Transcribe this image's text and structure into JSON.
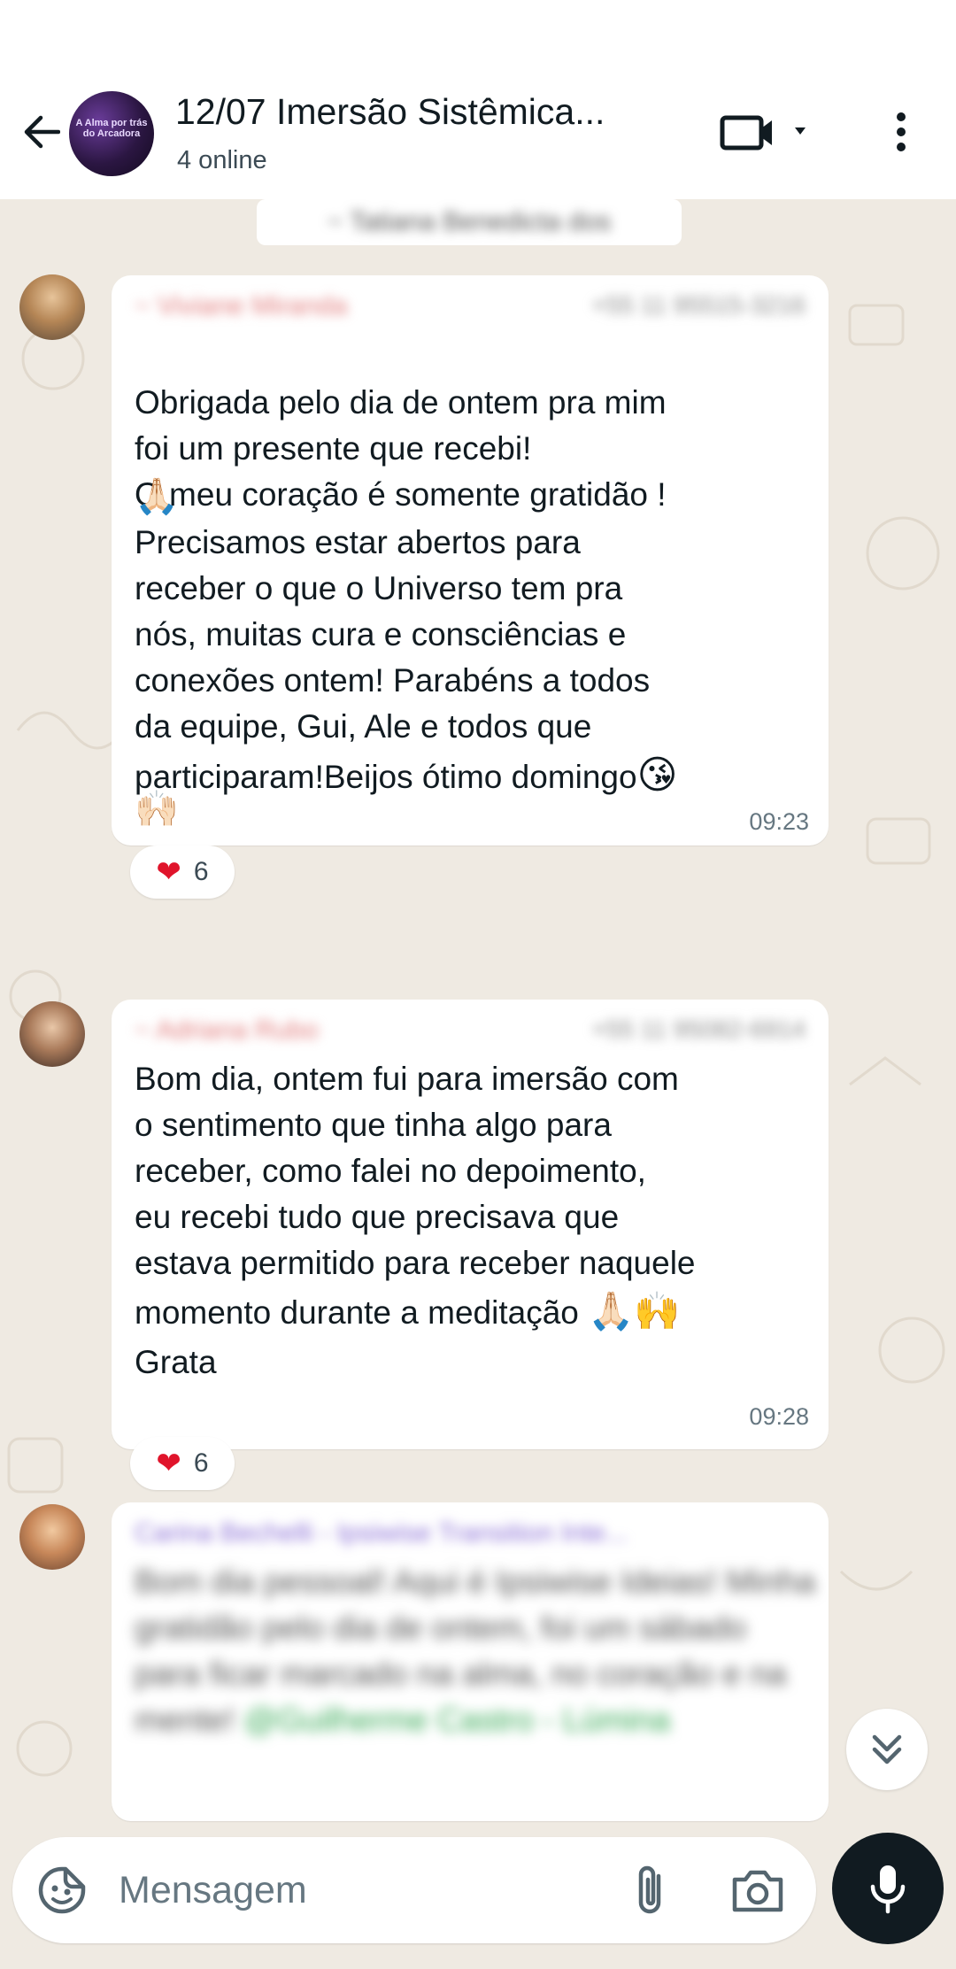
{
  "header": {
    "title": "12/07 Imersão Sistêmica...",
    "subtitle": "4 online",
    "avatar_text": "A Alma por trás do Arcadora"
  },
  "chat": {
    "date_chip": "~ Tatiana Benedicta dos",
    "messages": [
      {
        "sender": "~ Viviane Miranda",
        "phone": "+55 11 95515-3216",
        "text_a": "Obrigada pelo dia de ontem pra mim\nfoi um presente que recebi!\nO meu coração é somente gratidão !",
        "emoji_a": "🙏🏻",
        "text_b": "Precisamos estar abertos para\nreceber o que o Universo tem pra\nnós, muitas cura e consciências e\nconexões ontem! Parabéns a todos\nda equipe, Gui, Ale e todos que",
        "text_c": "participaram!Beijos ótimo domingo",
        "emoji_c": "😘",
        "emoji_d": "🙌🏻",
        "time": "09:23",
        "reaction_emoji": "❤",
        "reaction_count": "6"
      },
      {
        "sender": "~ Adriana Rubo",
        "phone": "+55 11 95082-6914",
        "text_a": "Bom dia, ontem fui para imersão com\no sentimento que tinha algo para\nreceber, como falei no depoimento,\neu recebi tudo que precisava que\nestava permitido para receber naquele",
        "text_b": "momento durante a meditação",
        "emoji_b": "🙏🏻🙌",
        "text_c": "Grata",
        "time": "09:28",
        "reaction_emoji": "❤",
        "reaction_count": "6"
      },
      {
        "sender": "Carina Bechelli - Ipsiwise Transition Inte...",
        "text": "Bom dia pessoal! Aqui é Ipsiwise Ideias! Minha gratidão pelo dia de ontem, foi um sábado para ficar marcado na alma, no coração e na mente!",
        "mention": "@Guilherme Castro - Lúmina"
      }
    ]
  },
  "composer": {
    "placeholder": "Mensagem"
  },
  "colors": {
    "chat_bg": "#efeae2",
    "bubble": "#ffffff",
    "sender1": "#e17c7c",
    "sender3": "#8a6fd6",
    "mention": "#34a853",
    "mic": "#111b21"
  }
}
